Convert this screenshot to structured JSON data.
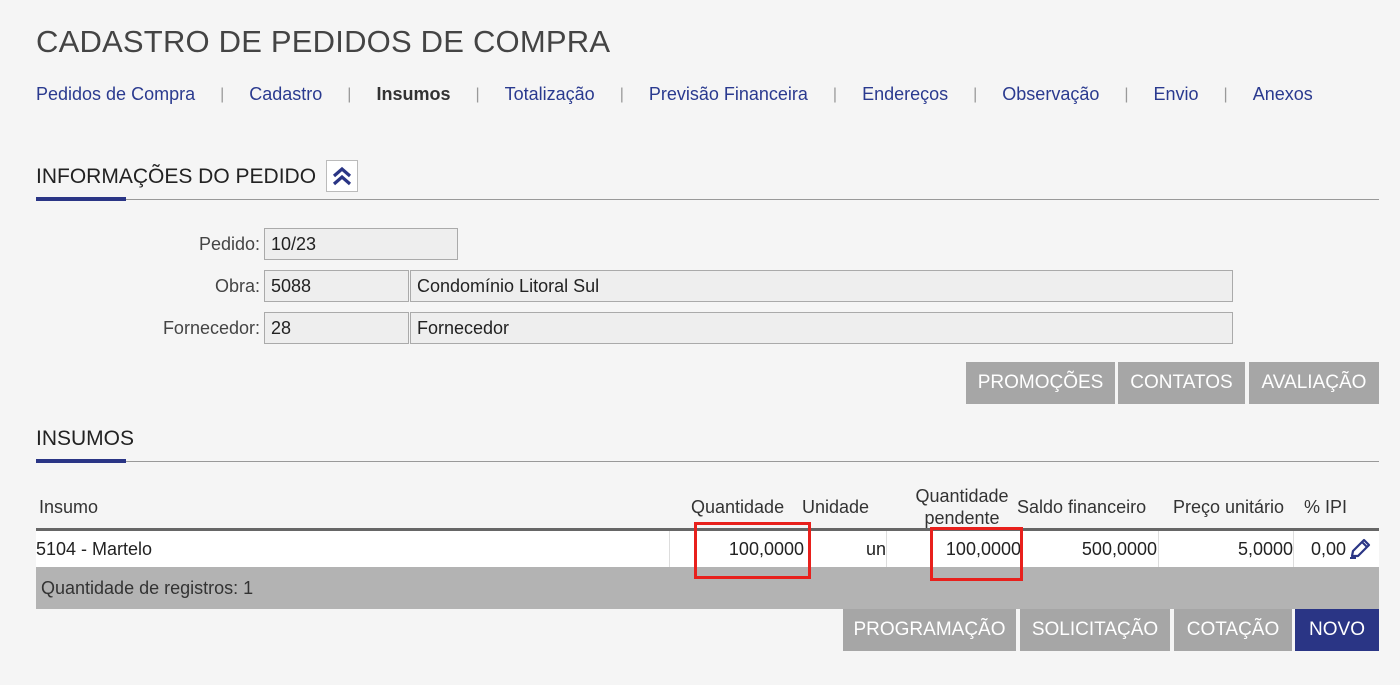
{
  "page": {
    "title": "CADASTRO DE PEDIDOS DE COMPRA"
  },
  "tabs": [
    {
      "label": "Pedidos de Compra"
    },
    {
      "label": "Cadastro"
    },
    {
      "label": "Insumos"
    },
    {
      "label": "Totalização"
    },
    {
      "label": "Previsão Financeira"
    },
    {
      "label": "Endereços"
    },
    {
      "label": "Observação"
    },
    {
      "label": "Envio"
    },
    {
      "label": "Anexos"
    }
  ],
  "tab_separator": "|",
  "order_info": {
    "title": "INFORMAÇÕES DO PEDIDO",
    "pedido_label": "Pedido:",
    "pedido_value": "10/23",
    "obra_label": "Obra:",
    "obra_code": "5088",
    "obra_name": "Condomínio Litoral Sul",
    "fornecedor_label": "Fornecedor:",
    "fornecedor_code": "28",
    "fornecedor_name": "Fornecedor",
    "buttons": {
      "promocoes": "PROMOÇÕES",
      "contatos": "CONTATOS",
      "avaliacao": "AVALIAÇÃO"
    }
  },
  "insumos": {
    "title": "INSUMOS",
    "columns": {
      "insumo": "Insumo",
      "quantidade": "Quantidade",
      "unidade": "Unidade",
      "quantidade_pendente_1": "Quantidade",
      "quantidade_pendente_2": "pendente",
      "saldo_financeiro": "Saldo financeiro",
      "preco_unitario": "Preço unitário",
      "ipi": "% IPI"
    },
    "rows": [
      {
        "insumo": "5104 - Martelo",
        "quantidade": "100,0000",
        "unidade": "un",
        "quantidade_pendente": "100,0000",
        "saldo_financeiro": "500,0000",
        "preco_unitario": "5,0000",
        "ipi": "0,00"
      }
    ],
    "record_count": "Quantidade de registros: 1",
    "buttons": {
      "programacao": "PROGRAMAÇÃO",
      "solicitacao": "SOLICITAÇÃO",
      "cotacao": "COTAÇÃO",
      "novo": "NOVO"
    }
  },
  "colors": {
    "accent": "#2a3585",
    "link": "#2a3a8f",
    "highlight": "#e8201c",
    "button_gray": "#a6a6a6"
  },
  "icons": {
    "collapse": "double-chevron-up-icon",
    "edit": "pencil-icon"
  }
}
